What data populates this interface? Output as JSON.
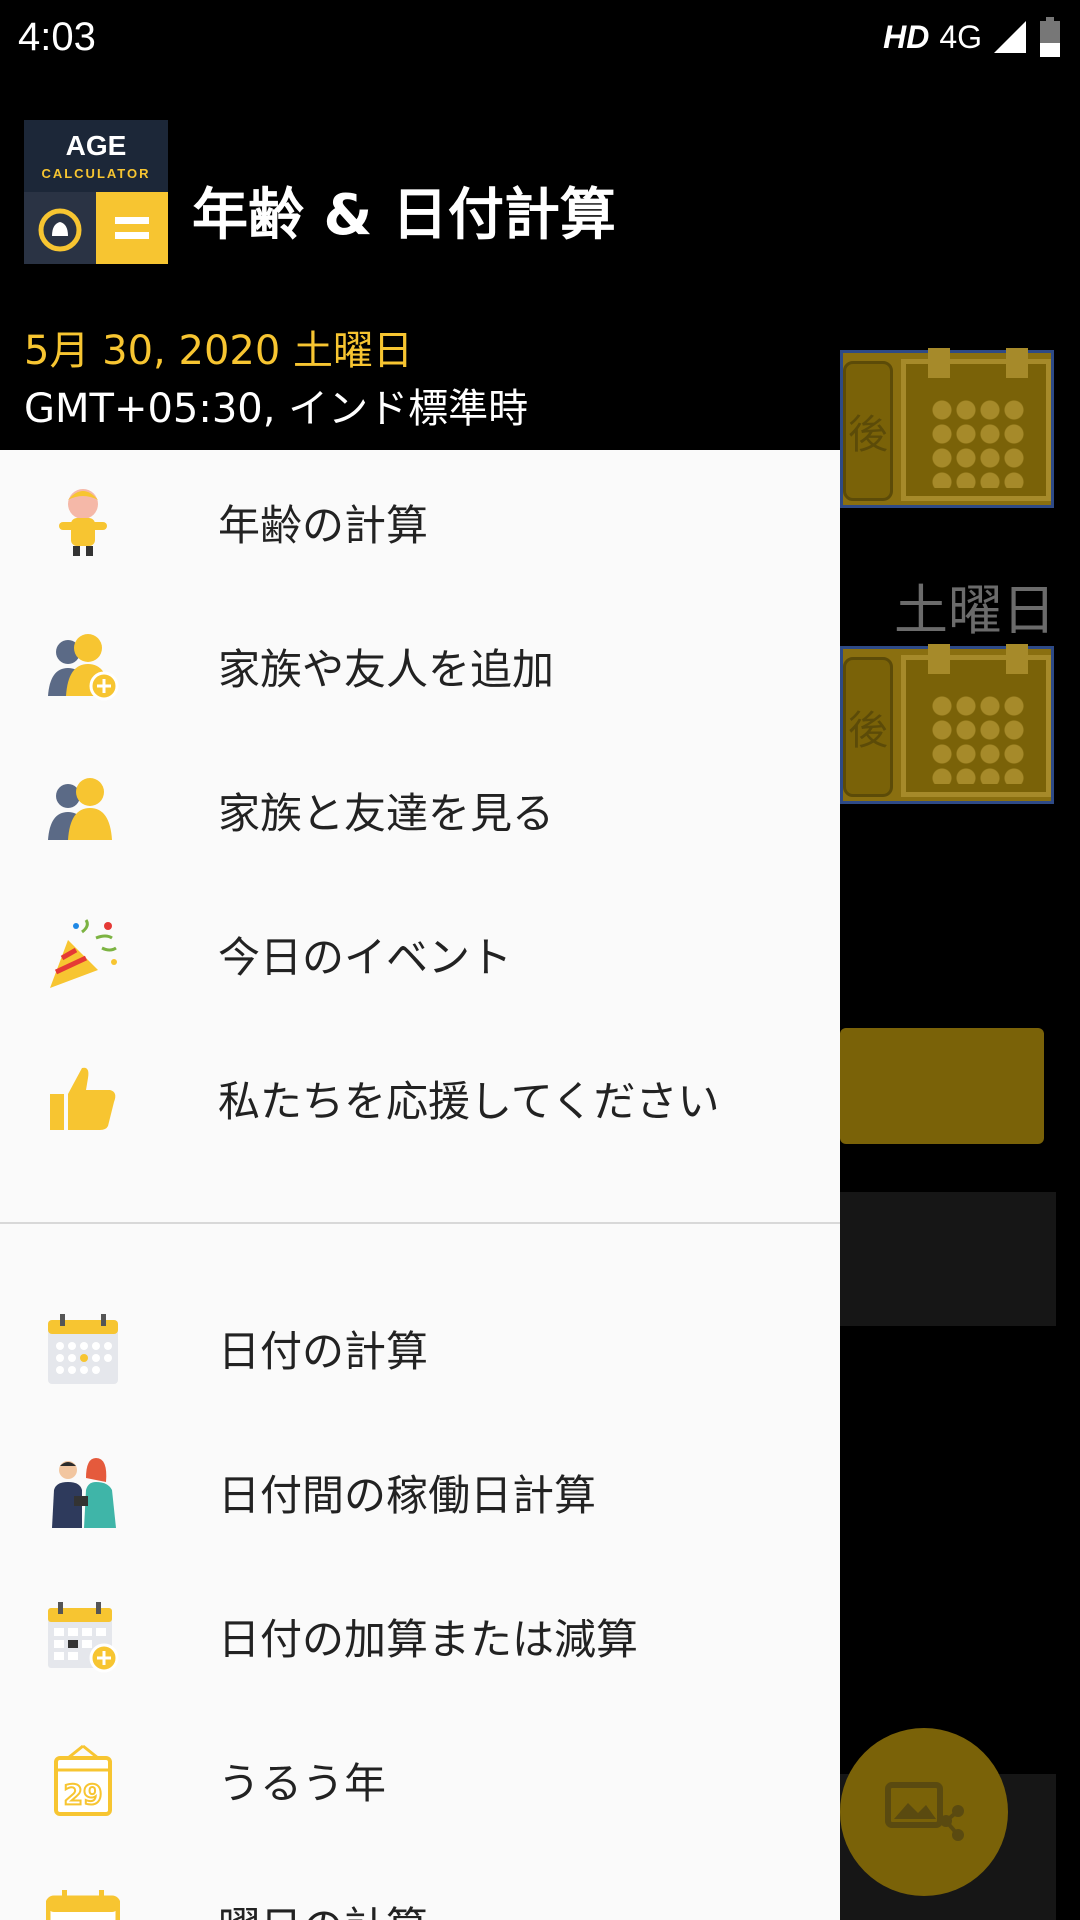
{
  "status_bar": {
    "time": "4:03",
    "hd": "HD",
    "network": "4G"
  },
  "background": {
    "button_char": "後",
    "weekday": "土曜日"
  },
  "drawer": {
    "logo": {
      "line1": "AGE",
      "line2": "CALCULATOR"
    },
    "title": "年齢 & 日付計算",
    "date": "5月 30, 2020 土曜日",
    "timezone": "GMT+05:30, インド標準時",
    "group1": [
      {
        "label": "年齢の計算",
        "icon": "child-icon"
      },
      {
        "label": "家族や友人を追加",
        "icon": "add-people-icon"
      },
      {
        "label": "家族と友達を見る",
        "icon": "people-icon"
      },
      {
        "label": "今日のイベント",
        "icon": "party-popper-icon"
      },
      {
        "label": "私たちを応援してください",
        "icon": "thumbs-up-icon"
      }
    ],
    "group2": [
      {
        "label": "日付の計算",
        "icon": "calendar-icon"
      },
      {
        "label": "日付間の稼働日計算",
        "icon": "working-people-icon"
      },
      {
        "label": "日付の加算または減算",
        "icon": "calendar-add-icon"
      },
      {
        "label": "うるう年",
        "icon": "leap-year-icon"
      },
      {
        "label": "曜日の計算",
        "icon": "sun-calendar-icon"
      }
    ]
  },
  "colors": {
    "accent": "#f7c531",
    "header_bg": "#000000",
    "drawer_bg": "#fafafa"
  }
}
